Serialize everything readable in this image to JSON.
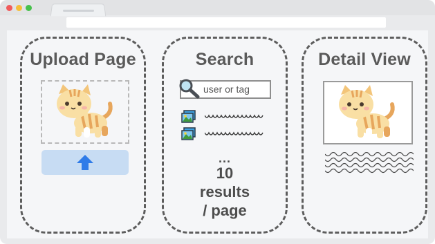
{
  "panels": [
    {
      "title": "Upload Page"
    },
    {
      "title": "Search",
      "search_placeholder": "user or tag",
      "summary_ellipsis": "...",
      "summary_count": "10",
      "summary_unit": "results",
      "summary_per": "/ page"
    },
    {
      "title": "Detail View"
    }
  ],
  "colors": {
    "panel_border": "#5d5d5d",
    "upload_button_bg": "#c7dcf3",
    "upload_arrow": "#2f7be8",
    "title_text": "#5a5a5a"
  },
  "icons": [
    "cat-image",
    "upload-arrow-icon",
    "search-icon",
    "image-thumbnail-icon"
  ]
}
